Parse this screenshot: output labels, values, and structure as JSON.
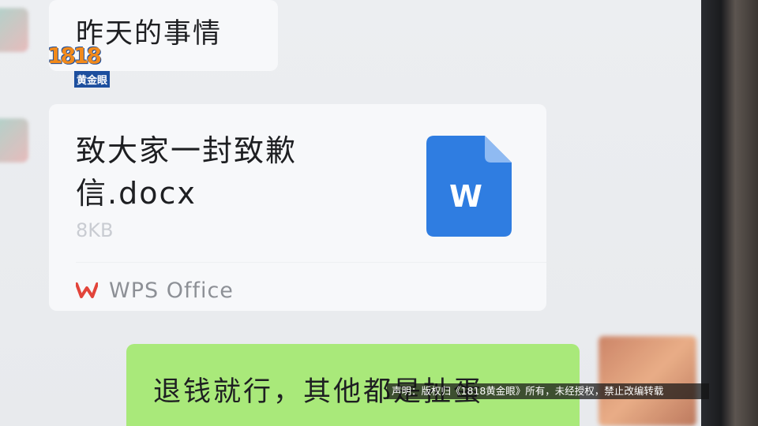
{
  "watermark": {
    "number": "1818",
    "tag": "黄金眼"
  },
  "messages": {
    "prev_text": "昨天的事情",
    "file": {
      "title": "致大家一封致歉信.docx",
      "size": "8KB",
      "app": "WPS Office",
      "icon_letter": "W"
    },
    "reply_text": "退钱就行，其他都是扯蛋"
  },
  "disclaimer": "声明：版权归《1818黄金眼》所有，未经授权，禁止改编转载",
  "colors": {
    "green_bubble": "#a9e97a",
    "doc_icon": "#2f7de1",
    "wps_logo": "#e2443a"
  }
}
